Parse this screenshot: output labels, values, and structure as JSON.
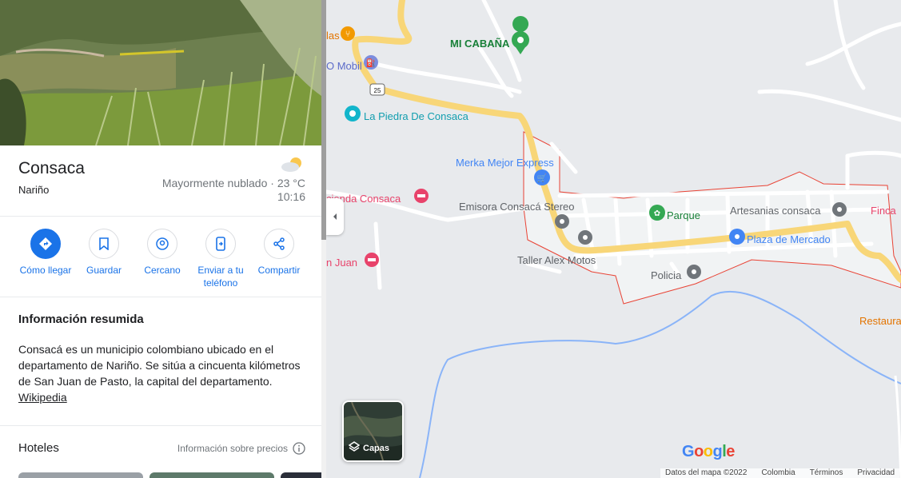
{
  "place": {
    "name": "Consaca",
    "region": "Nariño",
    "weather": {
      "condition_temp": "Mayormente nublado · 23 °C",
      "time": "10:16",
      "icon": "partly-cloudy-icon"
    }
  },
  "actions": [
    {
      "label": "Cómo llegar",
      "icon": "directions-icon"
    },
    {
      "label": "Guardar",
      "icon": "bookmark-icon"
    },
    {
      "label": "Cercano",
      "icon": "nearby-icon"
    },
    {
      "label": "Enviar a tu teléfono",
      "icon": "send-to-phone-icon"
    },
    {
      "label": "Compartir",
      "icon": "share-icon"
    }
  ],
  "summary": {
    "title": "Información resumida",
    "text": "Consacá es un municipio colombiano ubicado en el departamento de Nariño. Se sitúa a cincuenta kilómetros de San Juan de Pasto, la capital del departamento.",
    "link": "Wikipedia"
  },
  "hotels": {
    "title": "Hoteles",
    "price_info": "Información sobre precios"
  },
  "map": {
    "labels": {
      "las": "las",
      "mobil": "O Mobil",
      "mi_cabana": "MI CABAÑA",
      "route": "25",
      "piedra": "La Piedra De Consaca",
      "merka": "Merka Mejor Express",
      "hacienda": "cienda Consaca",
      "emisora": "Emisora Consacá Stereo",
      "parque": "Parque",
      "artesanias": "Artesanias consaca",
      "finca": "Finca",
      "plaza": "Plaza de Mercado",
      "taller": "Taller Alex Motos",
      "policia": "Policia",
      "juan": "n Juan",
      "restaura": "Restaura"
    },
    "layers_label": "Capas",
    "logo": "Google",
    "footer": [
      "Datos del mapa ©2022",
      "Colombia",
      "Términos",
      "Privacidad"
    ],
    "colors": {
      "water": "#8ab4f8",
      "road_major": "#f8d678",
      "boundary": "#e94335",
      "poi_green": "#34a853",
      "poi_blue": "#4285f4",
      "poi_pink": "#e8436b",
      "poi_orange": "#f29900",
      "poi_gray": "#70757a"
    }
  }
}
